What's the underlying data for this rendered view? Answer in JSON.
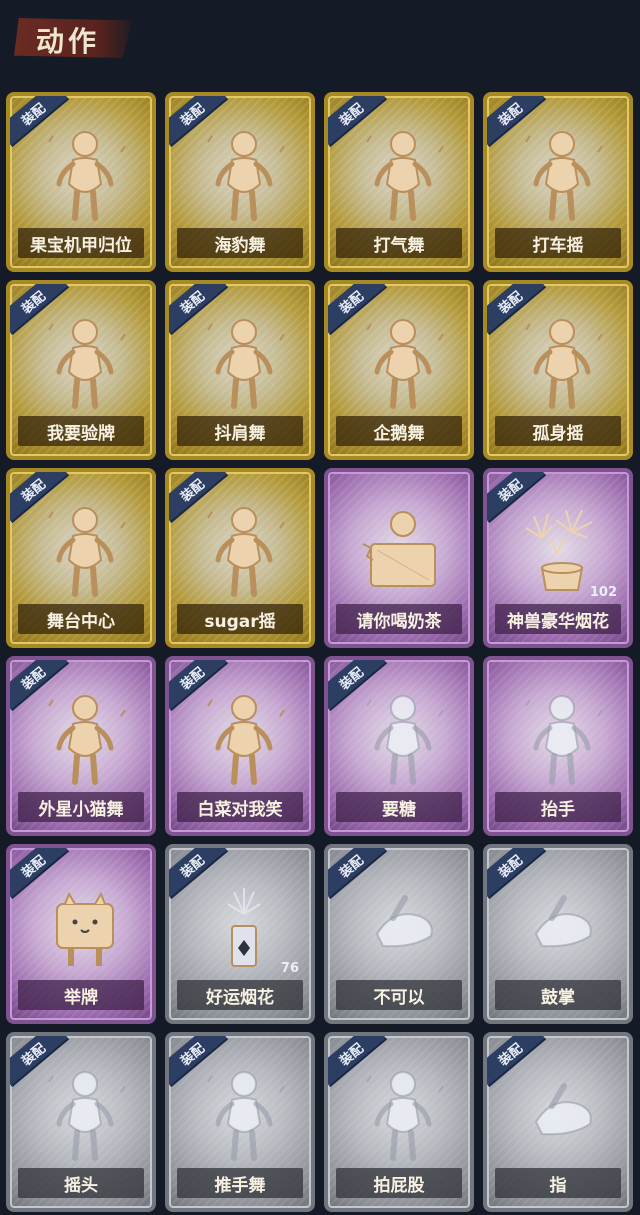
{
  "header": {
    "title": "动作"
  },
  "equip_tag": "装配",
  "cards": [
    {
      "label": "果宝机甲归位",
      "tier": "gold",
      "equipped": true,
      "icon": "dancer-hands-hips-icon"
    },
    {
      "label": "海豹舞",
      "tier": "gold",
      "equipped": true,
      "icon": "dancer-arm-cross-icon"
    },
    {
      "label": "打气舞",
      "tier": "gold",
      "equipped": true,
      "icon": "dancer-pump-icon"
    },
    {
      "label": "打车摇",
      "tier": "gold",
      "equipped": true,
      "icon": "dancer-wave-icon"
    },
    {
      "label": "我要验牌",
      "tier": "gold",
      "equipped": true,
      "icon": "dancer-card-icon"
    },
    {
      "label": "抖肩舞",
      "tier": "gold",
      "equipped": true,
      "icon": "dancer-shoulder-icon"
    },
    {
      "label": "企鹅舞",
      "tier": "gold",
      "equipped": true,
      "icon": "dancer-penguin-icon"
    },
    {
      "label": "孤身摇",
      "tier": "gold",
      "equipped": true,
      "icon": "dancer-solo-icon"
    },
    {
      "label": "舞台中心",
      "tier": "gold",
      "equipped": true,
      "icon": "dancer-center-icon"
    },
    {
      "label": "sugar摇",
      "tier": "gold",
      "equipped": true,
      "icon": "dancer-sugar-icon"
    },
    {
      "label": "请你喝奶茶",
      "tier": "purple",
      "equipped": false,
      "icon": "milk-tea-sign-icon"
    },
    {
      "label": "神兽豪华烟花",
      "tier": "purple",
      "equipped": true,
      "icon": "firework-box-icon",
      "count": "102"
    },
    {
      "label": "外星小猫舞",
      "tier": "purple",
      "equipped": true,
      "icon": "dancer-alien-cat-icon"
    },
    {
      "label": "白菜对我笑",
      "tier": "purple",
      "equipped": true,
      "icon": "dancer-cabbage-icon"
    },
    {
      "label": "要糖",
      "tier": "purple",
      "equipped": true,
      "icon": "ghost-reach-icon"
    },
    {
      "label": "抬手",
      "tier": "purple",
      "equipped": false,
      "icon": "ghost-raise-hand-icon"
    },
    {
      "label": "举牌",
      "tier": "purple",
      "equipped": true,
      "icon": "cat-sign-icon"
    },
    {
      "label": "好运烟花",
      "tier": "silver",
      "equipped": true,
      "icon": "firework-can-icon",
      "count": "76"
    },
    {
      "label": "不可以",
      "tier": "silver",
      "equipped": true,
      "icon": "finger-wag-icon"
    },
    {
      "label": "鼓掌",
      "tier": "silver",
      "equipped": true,
      "icon": "clap-hands-icon"
    },
    {
      "label": "摇头",
      "tier": "silver",
      "equipped": true,
      "icon": "ghost-shake-head-icon"
    },
    {
      "label": "推手舞",
      "tier": "silver",
      "equipped": true,
      "icon": "ghost-push-hands-icon"
    },
    {
      "label": "拍屁股",
      "tier": "silver",
      "equipped": true,
      "icon": "ghost-slap-icon"
    },
    {
      "label": "指",
      "tier": "silver",
      "equipped": true,
      "icon": "pointing-hand-icon"
    }
  ]
}
